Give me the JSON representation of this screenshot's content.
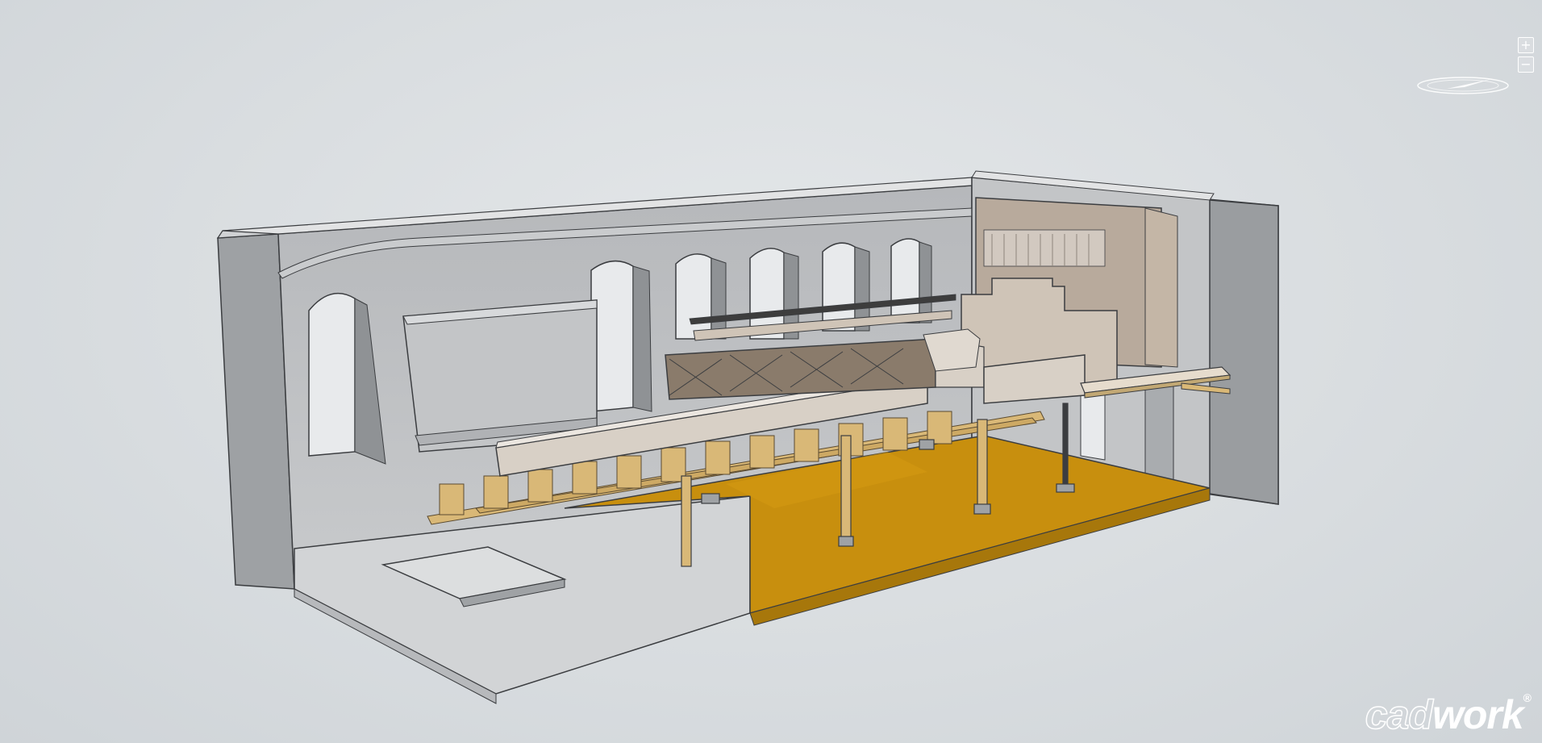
{
  "app": {
    "logo_part1": "cad",
    "logo_part2": "work",
    "logo_mark": "®"
  },
  "controls": {
    "zoom_in_label": "+",
    "zoom_out_label": "−",
    "compass_icon": "compass-icon"
  },
  "scene": {
    "wall_color": "#a9acb0",
    "wall_inner_color": "#c4c7ca",
    "floor_timber_color": "#c88f0e",
    "floor_concrete_color": "#d2d4d6",
    "timber_color": "#d9b877",
    "panel_color": "#d8d0c6"
  }
}
